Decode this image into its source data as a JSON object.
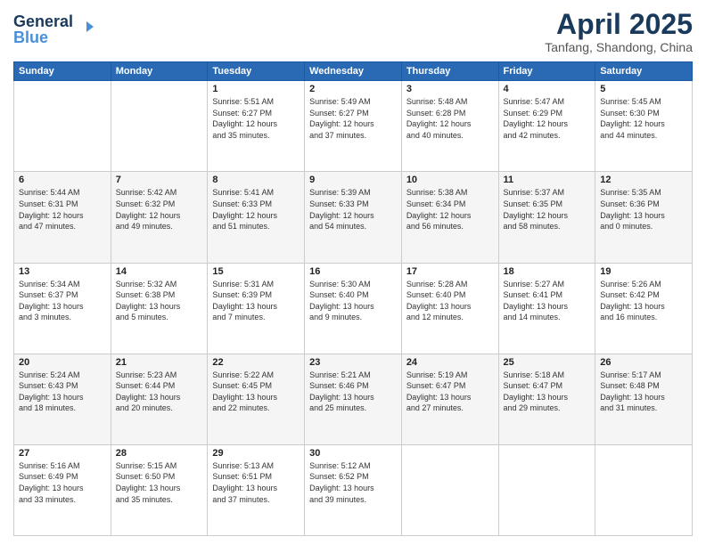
{
  "header": {
    "logo_line1": "General",
    "logo_line2": "Blue",
    "month_title": "April 2025",
    "subtitle": "Tanfang, Shandong, China"
  },
  "weekdays": [
    "Sunday",
    "Monday",
    "Tuesday",
    "Wednesday",
    "Thursday",
    "Friday",
    "Saturday"
  ],
  "weeks": [
    [
      {
        "day": "",
        "info": ""
      },
      {
        "day": "",
        "info": ""
      },
      {
        "day": "1",
        "info": "Sunrise: 5:51 AM\nSunset: 6:27 PM\nDaylight: 12 hours\nand 35 minutes."
      },
      {
        "day": "2",
        "info": "Sunrise: 5:49 AM\nSunset: 6:27 PM\nDaylight: 12 hours\nand 37 minutes."
      },
      {
        "day": "3",
        "info": "Sunrise: 5:48 AM\nSunset: 6:28 PM\nDaylight: 12 hours\nand 40 minutes."
      },
      {
        "day": "4",
        "info": "Sunrise: 5:47 AM\nSunset: 6:29 PM\nDaylight: 12 hours\nand 42 minutes."
      },
      {
        "day": "5",
        "info": "Sunrise: 5:45 AM\nSunset: 6:30 PM\nDaylight: 12 hours\nand 44 minutes."
      }
    ],
    [
      {
        "day": "6",
        "info": "Sunrise: 5:44 AM\nSunset: 6:31 PM\nDaylight: 12 hours\nand 47 minutes."
      },
      {
        "day": "7",
        "info": "Sunrise: 5:42 AM\nSunset: 6:32 PM\nDaylight: 12 hours\nand 49 minutes."
      },
      {
        "day": "8",
        "info": "Sunrise: 5:41 AM\nSunset: 6:33 PM\nDaylight: 12 hours\nand 51 minutes."
      },
      {
        "day": "9",
        "info": "Sunrise: 5:39 AM\nSunset: 6:33 PM\nDaylight: 12 hours\nand 54 minutes."
      },
      {
        "day": "10",
        "info": "Sunrise: 5:38 AM\nSunset: 6:34 PM\nDaylight: 12 hours\nand 56 minutes."
      },
      {
        "day": "11",
        "info": "Sunrise: 5:37 AM\nSunset: 6:35 PM\nDaylight: 12 hours\nand 58 minutes."
      },
      {
        "day": "12",
        "info": "Sunrise: 5:35 AM\nSunset: 6:36 PM\nDaylight: 13 hours\nand 0 minutes."
      }
    ],
    [
      {
        "day": "13",
        "info": "Sunrise: 5:34 AM\nSunset: 6:37 PM\nDaylight: 13 hours\nand 3 minutes."
      },
      {
        "day": "14",
        "info": "Sunrise: 5:32 AM\nSunset: 6:38 PM\nDaylight: 13 hours\nand 5 minutes."
      },
      {
        "day": "15",
        "info": "Sunrise: 5:31 AM\nSunset: 6:39 PM\nDaylight: 13 hours\nand 7 minutes."
      },
      {
        "day": "16",
        "info": "Sunrise: 5:30 AM\nSunset: 6:40 PM\nDaylight: 13 hours\nand 9 minutes."
      },
      {
        "day": "17",
        "info": "Sunrise: 5:28 AM\nSunset: 6:40 PM\nDaylight: 13 hours\nand 12 minutes."
      },
      {
        "day": "18",
        "info": "Sunrise: 5:27 AM\nSunset: 6:41 PM\nDaylight: 13 hours\nand 14 minutes."
      },
      {
        "day": "19",
        "info": "Sunrise: 5:26 AM\nSunset: 6:42 PM\nDaylight: 13 hours\nand 16 minutes."
      }
    ],
    [
      {
        "day": "20",
        "info": "Sunrise: 5:24 AM\nSunset: 6:43 PM\nDaylight: 13 hours\nand 18 minutes."
      },
      {
        "day": "21",
        "info": "Sunrise: 5:23 AM\nSunset: 6:44 PM\nDaylight: 13 hours\nand 20 minutes."
      },
      {
        "day": "22",
        "info": "Sunrise: 5:22 AM\nSunset: 6:45 PM\nDaylight: 13 hours\nand 22 minutes."
      },
      {
        "day": "23",
        "info": "Sunrise: 5:21 AM\nSunset: 6:46 PM\nDaylight: 13 hours\nand 25 minutes."
      },
      {
        "day": "24",
        "info": "Sunrise: 5:19 AM\nSunset: 6:47 PM\nDaylight: 13 hours\nand 27 minutes."
      },
      {
        "day": "25",
        "info": "Sunrise: 5:18 AM\nSunset: 6:47 PM\nDaylight: 13 hours\nand 29 minutes."
      },
      {
        "day": "26",
        "info": "Sunrise: 5:17 AM\nSunset: 6:48 PM\nDaylight: 13 hours\nand 31 minutes."
      }
    ],
    [
      {
        "day": "27",
        "info": "Sunrise: 5:16 AM\nSunset: 6:49 PM\nDaylight: 13 hours\nand 33 minutes."
      },
      {
        "day": "28",
        "info": "Sunrise: 5:15 AM\nSunset: 6:50 PM\nDaylight: 13 hours\nand 35 minutes."
      },
      {
        "day": "29",
        "info": "Sunrise: 5:13 AM\nSunset: 6:51 PM\nDaylight: 13 hours\nand 37 minutes."
      },
      {
        "day": "30",
        "info": "Sunrise: 5:12 AM\nSunset: 6:52 PM\nDaylight: 13 hours\nand 39 minutes."
      },
      {
        "day": "",
        "info": ""
      },
      {
        "day": "",
        "info": ""
      },
      {
        "day": "",
        "info": ""
      }
    ]
  ]
}
